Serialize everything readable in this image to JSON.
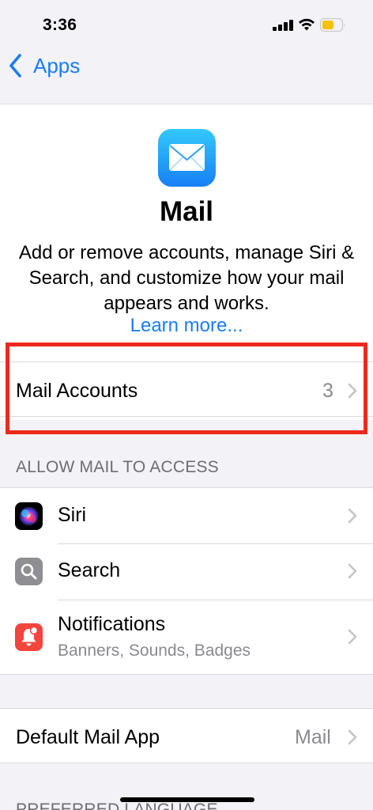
{
  "status_bar": {
    "time": "3:36"
  },
  "nav": {
    "back_label": "Apps"
  },
  "header": {
    "title": "Mail",
    "description": "Add or remove accounts, manage Siri & Search, and customize how your mail appears and works.",
    "learn_more": "Learn more..."
  },
  "mail_accounts": {
    "label": "Mail Accounts",
    "value": "3"
  },
  "access_section": {
    "title": "ALLOW MAIL TO ACCESS",
    "items": [
      {
        "label": "Siri",
        "icon": "siri-icon"
      },
      {
        "label": "Search",
        "icon": "search-icon"
      },
      {
        "label": "Notifications",
        "subtitle": "Banners, Sounds, Badges",
        "icon": "notifications-icon"
      }
    ]
  },
  "default_app": {
    "label": "Default Mail App",
    "value": "Mail"
  },
  "next_section": {
    "title": "PREFERRED LANGUAGE"
  },
  "colors": {
    "accent": "#1a7cf5",
    "highlight": "#ec2a1c",
    "notifications": "#f2453d",
    "search": "#8e8e93"
  }
}
